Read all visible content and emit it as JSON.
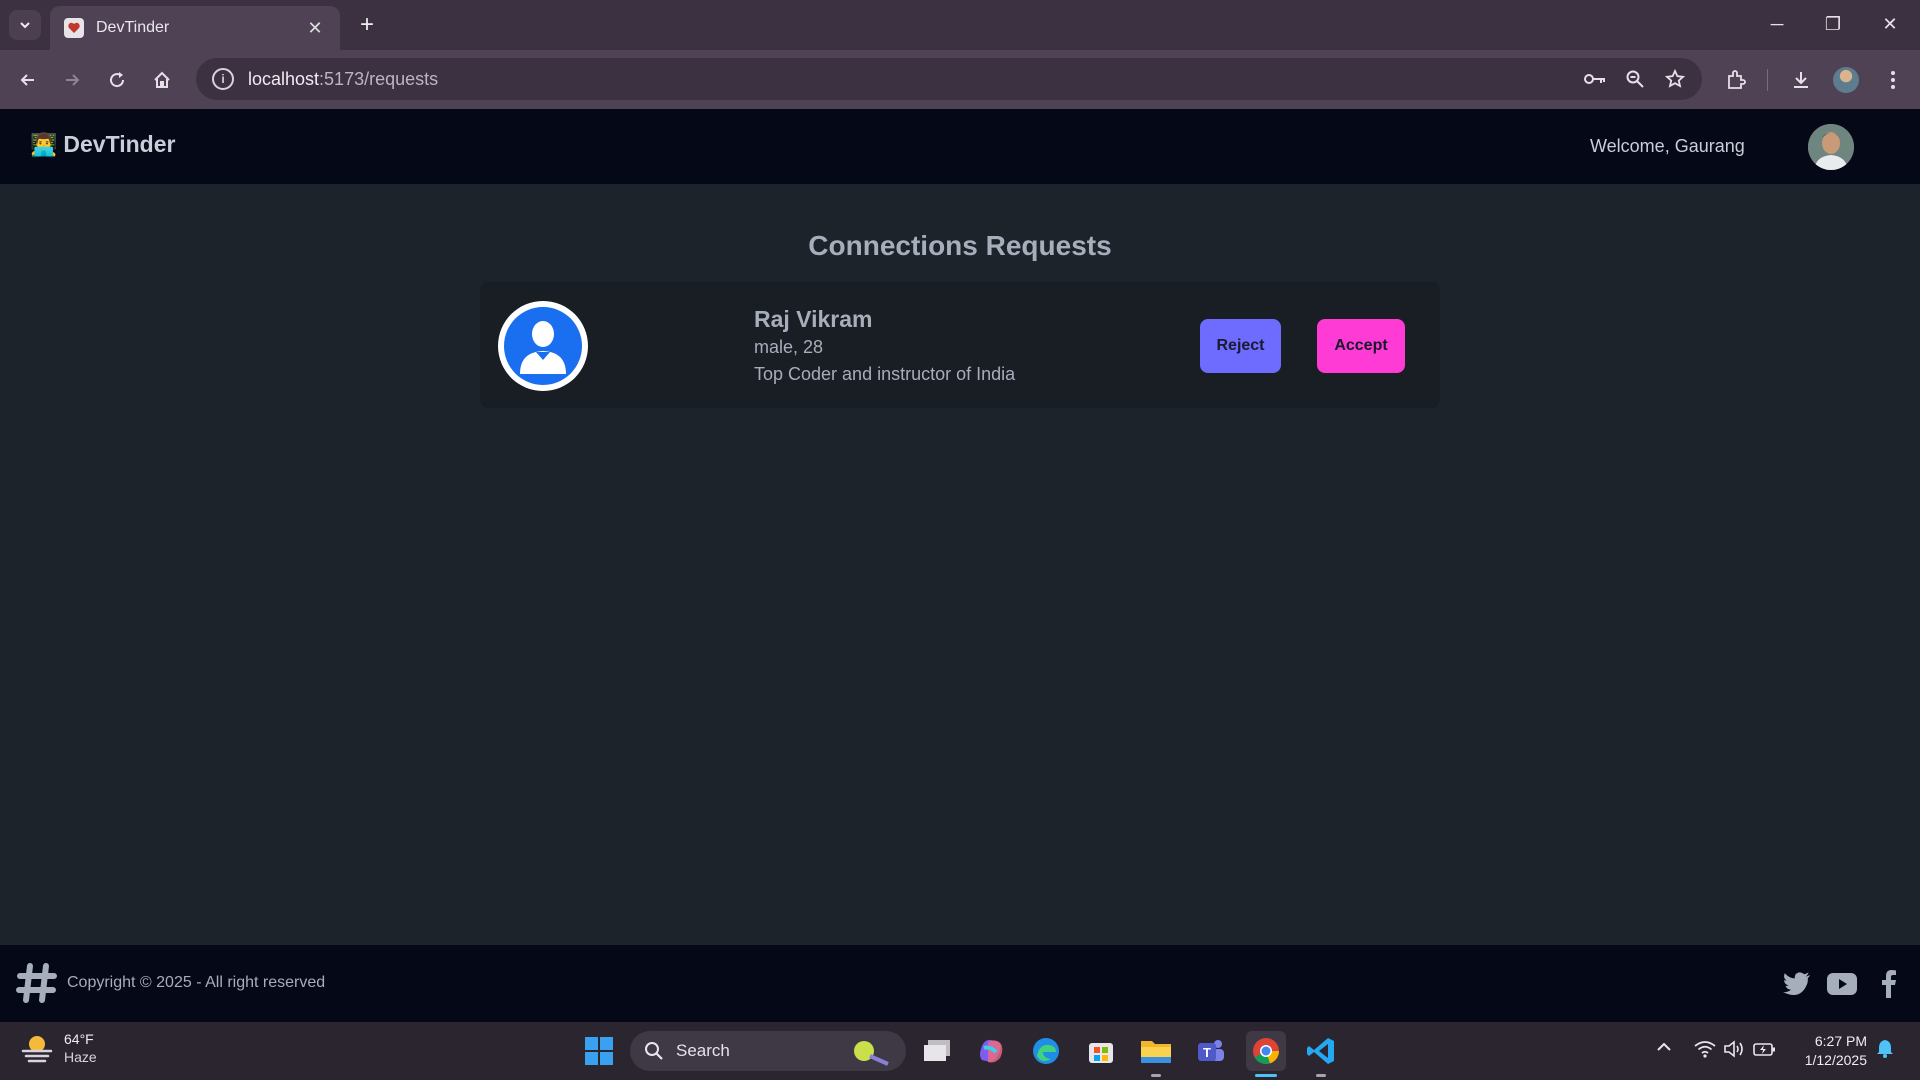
{
  "browser": {
    "tab_title": "DevTinder",
    "url_host": "localhost",
    "url_path": ":5173/requests"
  },
  "navbar": {
    "brand_emoji": "👨‍💻",
    "brand": "DevTinder",
    "welcome": "Welcome, Gaurang"
  },
  "main": {
    "title": "Connections Requests",
    "requests": [
      {
        "name": "Raj Vikram",
        "meta": "male, 28",
        "about": "Top Coder and instructor of India",
        "reject_label": "Reject",
        "accept_label": "Accept"
      }
    ]
  },
  "footer": {
    "copyright": "Copyright © 2025 - All right reserved"
  },
  "taskbar": {
    "weather_temp": "64°F",
    "weather_desc": "Haze",
    "search_label": "Search",
    "time": "6:27 PM",
    "date": "1/12/2025"
  },
  "colors": {
    "accent_reject": "#6d6cff",
    "accent_accept": "#ff3bd5",
    "navbar_bg": "#050816",
    "page_bg": "#1d232a",
    "card_bg": "#191e24"
  }
}
